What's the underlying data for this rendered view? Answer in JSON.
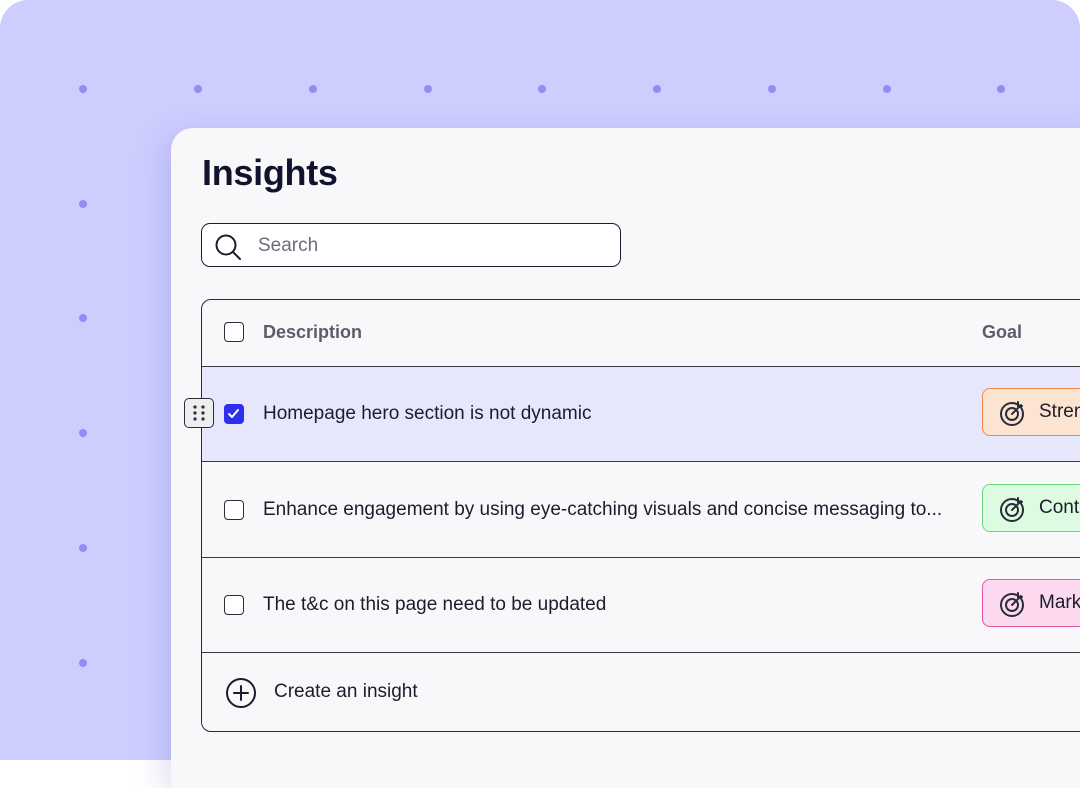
{
  "page": {
    "title": "Insights"
  },
  "search": {
    "placeholder": "Search"
  },
  "table": {
    "columns": {
      "description": "Description",
      "goal": "Goal"
    },
    "rows": [
      {
        "description": "Homepage hero section is not dynamic",
        "goal": "Stren",
        "checked": true,
        "goal_color": "#f08a46"
      },
      {
        "description": "Enhance engagement by using eye-catching visuals and concise messaging to...",
        "goal": "Cont",
        "checked": false,
        "goal_color": "#68d779"
      },
      {
        "description": "The t&c on this page need to be updated",
        "goal": "Mark",
        "checked": false,
        "goal_color": "#e4559f"
      }
    ],
    "create_label": "Create an insight"
  },
  "colors": {
    "background": "#cdcdfe",
    "accent": "#2d2ff0",
    "selected_row": "#e6e6fd"
  },
  "icons": [
    "search-icon",
    "checkmark-icon",
    "target-icon",
    "drag-handle-icon",
    "plus-circle-icon"
  ]
}
